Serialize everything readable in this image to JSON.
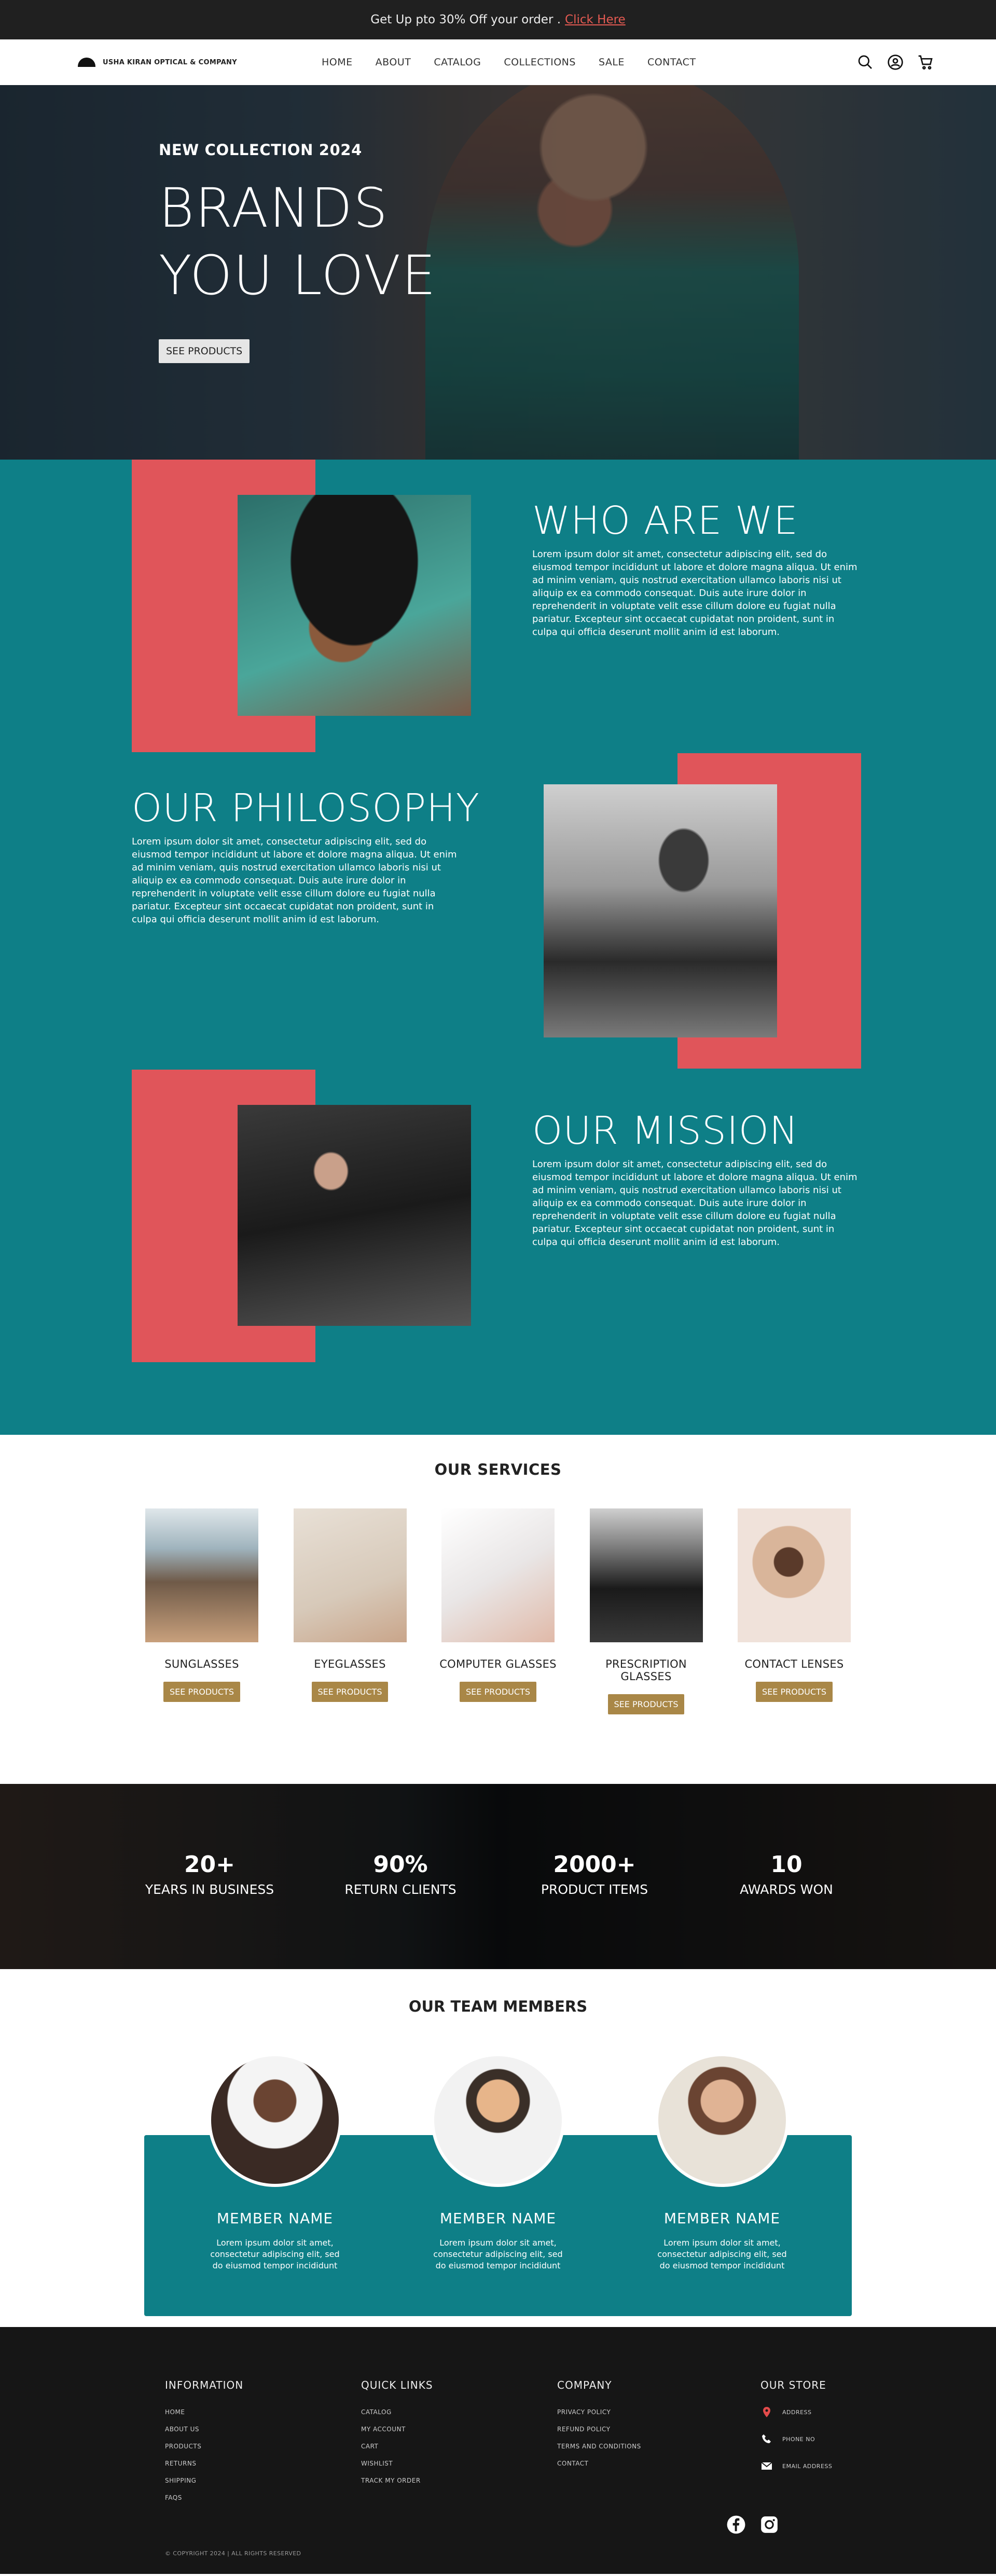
{
  "topbar": {
    "text": "Get Up  pto 30% Off your order .",
    "link": "Click Here"
  },
  "brand": {
    "name": "USHA KIRAN OPTICAL & COMPANY"
  },
  "nav": {
    "items": [
      "HOME",
      "ABOUT",
      "CATALOG",
      "COLLECTIONS",
      "SALE",
      "CONTACT"
    ]
  },
  "hero": {
    "kicker": "NEW COLLECTION 2024",
    "title_line1": "BRANDS",
    "title_line2": "YOU LOVE",
    "button": "SEE PRODUCTS"
  },
  "sections": [
    {
      "title": "WHO ARE WE",
      "body": "Lorem ipsum dolor sit amet, consectetur adipiscing elit, sed do eiusmod tempor incididunt ut labore et dolore magna aliqua. Ut enim ad minim veniam, quis nostrud exercitation ullamco laboris nisi ut aliquip ex ea commodo consequat. Duis aute irure dolor in reprehenderit in voluptate velit esse cillum dolore eu fugiat nulla pariatur. Excepteur sint occaecat cupidatat non proident, sunt in culpa qui officia deserunt mollit anim id est laborum."
    },
    {
      "title": "OUR PHILOSOPHY",
      "body": "Lorem ipsum dolor sit amet, consectetur adipiscing elit, sed do eiusmod tempor incididunt ut labore et dolore magna aliqua. Ut enim ad minim veniam, quis nostrud exercitation ullamco laboris nisi ut aliquip ex ea commodo consequat. Duis aute irure dolor in reprehenderit in voluptate velit esse cillum dolore eu fugiat nulla pariatur. Excepteur sint occaecat cupidatat non proident, sunt in culpa qui officia deserunt mollit anim id est laborum."
    },
    {
      "title": "OUR MISSION",
      "body": "Lorem ipsum dolor sit amet, consectetur adipiscing elit, sed do eiusmod tempor incididunt ut labore et dolore magna aliqua. Ut enim ad minim veniam, quis nostrud exercitation ullamco laboris nisi ut aliquip ex ea commodo consequat. Duis aute irure dolor in reprehenderit in voluptate velit esse cillum dolore eu fugiat nulla pariatur. Excepteur sint occaecat cupidatat non proident, sunt in culpa qui officia deserunt mollit anim id est laborum."
    }
  ],
  "services": {
    "title": "OUR SERVICES",
    "button": "SEE PRODUCTS",
    "items": [
      "SUNGLASSES",
      "EYEGLASSES",
      "COMPUTER GLASSES",
      "PRESCRIPTION GLASSES",
      "CONTACT LENSES"
    ]
  },
  "stats": [
    {
      "value": "20+",
      "label": "YEARS IN BUSINESS"
    },
    {
      "value": "90%",
      "label": "RETURN CLIENTS"
    },
    {
      "value": "2000+",
      "label": "PRODUCT ITEMS"
    },
    {
      "value": "10",
      "label": "AWARDS WON"
    }
  ],
  "team": {
    "title": "OUR TEAM MEMBERS",
    "members": [
      {
        "name": "MEMBER NAME",
        "text": "Lorem ipsum dolor sit amet, consectetur adipiscing elit, sed do eiusmod tempor incididunt"
      },
      {
        "name": "MEMBER NAME",
        "text": "Lorem ipsum dolor sit amet, consectetur adipiscing elit, sed do eiusmod tempor incididunt"
      },
      {
        "name": "MEMBER NAME",
        "text": "Lorem ipsum dolor sit amet, consectetur adipiscing elit, sed do eiusmod tempor incididunt"
      }
    ]
  },
  "footer": {
    "information": {
      "title": "INFORMATION",
      "links": [
        "HOME",
        "ABOUT US",
        "PRODUCTS",
        "RETURNS",
        "SHIPPING",
        "FAQS"
      ]
    },
    "quick_links": {
      "title": "QUICK LINKS",
      "links": [
        "CATALOG",
        "MY ACCOUNT",
        "CART",
        "WISHLIST",
        "TRACK MY ORDER"
      ]
    },
    "company": {
      "title": "COMPANY",
      "links": [
        "PRIVACY POLICY",
        "REFUND POLICY",
        "TERMS AND CONDITIONS",
        "CONTACT"
      ]
    },
    "store": {
      "title": "OUR STORE",
      "address": "ADDRESS",
      "phone": "PHONE NO",
      "email": "EMAIL ADDRESS"
    },
    "copyright": "© COPYRIGHT 2024 | ALL RIGHTS RESERVED"
  },
  "colors": {
    "teal": "#0e7f87",
    "coral": "#e0555a",
    "gold": "#a98747",
    "dark": "#161616"
  }
}
